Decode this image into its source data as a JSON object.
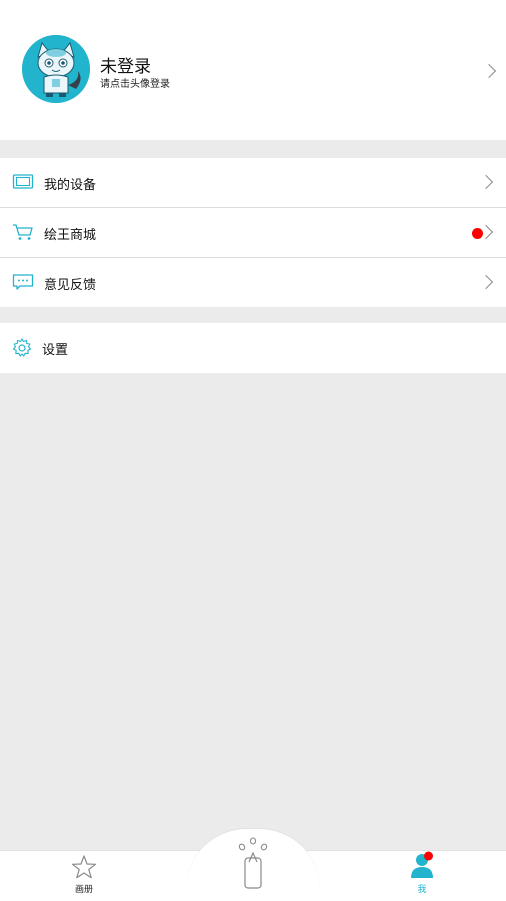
{
  "profile": {
    "name": "未登录",
    "hint": "请点击头像登录"
  },
  "menu": {
    "group1": [
      {
        "label": "我的设备",
        "icon": "device-icon"
      },
      {
        "label": "绘王商城",
        "icon": "cart-icon",
        "badge": true
      },
      {
        "label": "意见反馈",
        "icon": "feedback-icon"
      }
    ],
    "group2": [
      {
        "label": "设置",
        "icon": "gear-icon"
      }
    ]
  },
  "tabs": {
    "album": "画册",
    "me": "我"
  },
  "colors": {
    "accent": "#22b4cc",
    "badge": "#ff0000",
    "background": "#ebebeb"
  }
}
